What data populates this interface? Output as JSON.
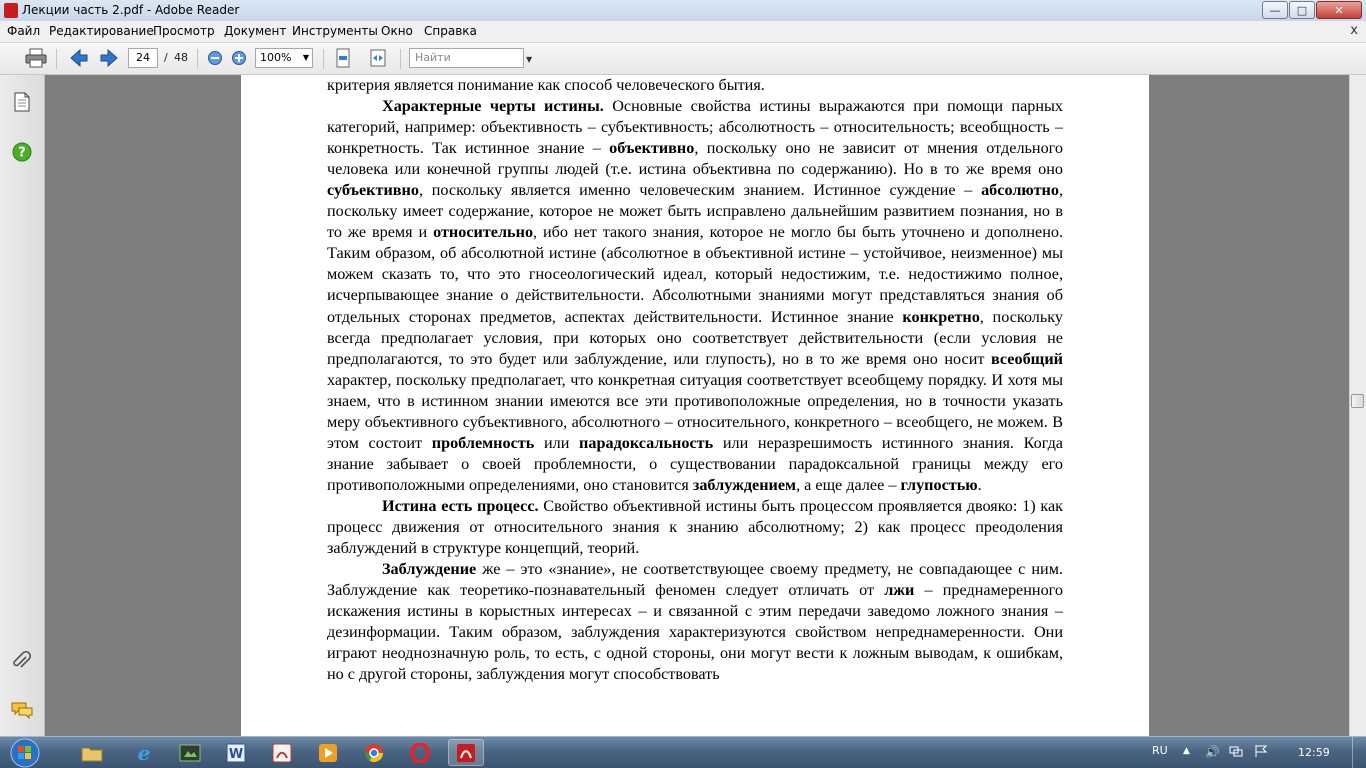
{
  "window": {
    "title": "Лекции часть 2.pdf - Adobe Reader"
  },
  "menu": [
    "Файл",
    "Редактирование",
    "Просмотр",
    "Документ",
    "Инструменты",
    "Окно",
    "Справка"
  ],
  "menu_close": "x",
  "toolbar": {
    "current_page": "24",
    "page_separator": "/",
    "total_pages": "48",
    "zoom": "100%",
    "search_placeholder": "Найти"
  },
  "document": {
    "paragraphs": [
      [
        {
          "t": "критерия является понимание как способ человеческого бытия."
        }
      ],
      [
        {
          "t": "Характерные черты истины.",
          "b": true
        },
        {
          "t": " Основные свойства истины выражаются при помощи парных категорий, например: объективность – субъективность; абсолютность – относительность; всеобщность – конкретность. Так истинное знание – "
        },
        {
          "t": "объективно",
          "b": true
        },
        {
          "t": ", поскольку оно не зависит от мнения отдельного человека или конечной группы людей (т.е. истина объективна по содержанию). Но в то же время оно "
        },
        {
          "t": "субъективно",
          "b": true
        },
        {
          "t": ", поскольку является именно человеческим знанием. Истинное суждение – "
        },
        {
          "t": "абсолютно",
          "b": true
        },
        {
          "t": ", поскольку имеет содержание, которое не может быть исправлено дальнейшим развитием познания, но в то же время и "
        },
        {
          "t": "относительно",
          "b": true
        },
        {
          "t": ", ибо нет такого знания, которое не могло бы быть уточнено и дополнено. Таким образом, об абсолютной истине (абсолютное в объективной истине – устойчивое, неизменное) мы можем сказать то, что это гносеологический идеал, который недостижим, т.е. недостижимо полное, исчерпывающее знание о действительности. Абсолютными знаниями могут представляться знания об отдельных сторонах предметов, аспектах действительности. Истинное знание "
        },
        {
          "t": "конкретно",
          "b": true
        },
        {
          "t": ", поскольку всегда предполагает условия, при которых оно соответствует действительности (если условия не предполагаются, то это будет или заблуждение, или глупость), но в то же время оно носит "
        },
        {
          "t": "всеобщий",
          "b": true
        },
        {
          "t": " характер, поскольку предполагает, что конкретная ситуация соответствует всеобщему порядку. И хотя мы знаем, что в истинном знании имеются все эти противоположные определения, но в точности указать меру объективного субъективного, абсолютного – относительного, конкретного – всеобщего, не можем. В этом состоит "
        },
        {
          "t": "проблемность",
          "b": true
        },
        {
          "t": " или "
        },
        {
          "t": "парадоксальность",
          "b": true
        },
        {
          "t": " или неразрешимость истинного знания. Когда знание забывает о своей проблемности, о существовании парадоксальной границы между его противоположными определениями, оно становится "
        },
        {
          "t": "заблуждением",
          "b": true
        },
        {
          "t": ", а еще далее – "
        },
        {
          "t": "глупостью",
          "b": true
        },
        {
          "t": "."
        }
      ],
      [
        {
          "t": "Истина есть процесс.",
          "b": true
        },
        {
          "t": " Свойство объективной истины быть процессом проявляется двояко: 1) как процесс движения от относительного знания к знанию абсолютному; 2) как процесс преодоления заблуждений в структуре концепций, теорий."
        }
      ],
      [
        {
          "t": "Заблуждение",
          "b": true
        },
        {
          "t": " же – это «знание», не соответствующее своему предмету, не совпадающее с ним. Заблуждение как теоретико-познавательный феномен следует отличать от "
        },
        {
          "t": "лжи",
          "b": true
        },
        {
          "t": " – преднамеренного искажения истины в корыстных интересах – и связанной с этим передачи заведомо ложного знания – дезинформации. Таким образом, заблуждения характеризуются свойством непреднамеренности. Они играют неоднозначную роль, то есть, с одной стороны, они могут вести к ложным выводам, к ошибкам, но с другой стороны, заблуждения могут способствовать"
        }
      ]
    ]
  },
  "tray": {
    "language": "RU",
    "time": "12:59"
  },
  "colors": {
    "page": "#ffffff",
    "workspace": "#7e7e7e",
    "taskbar": "#4a6582"
  }
}
